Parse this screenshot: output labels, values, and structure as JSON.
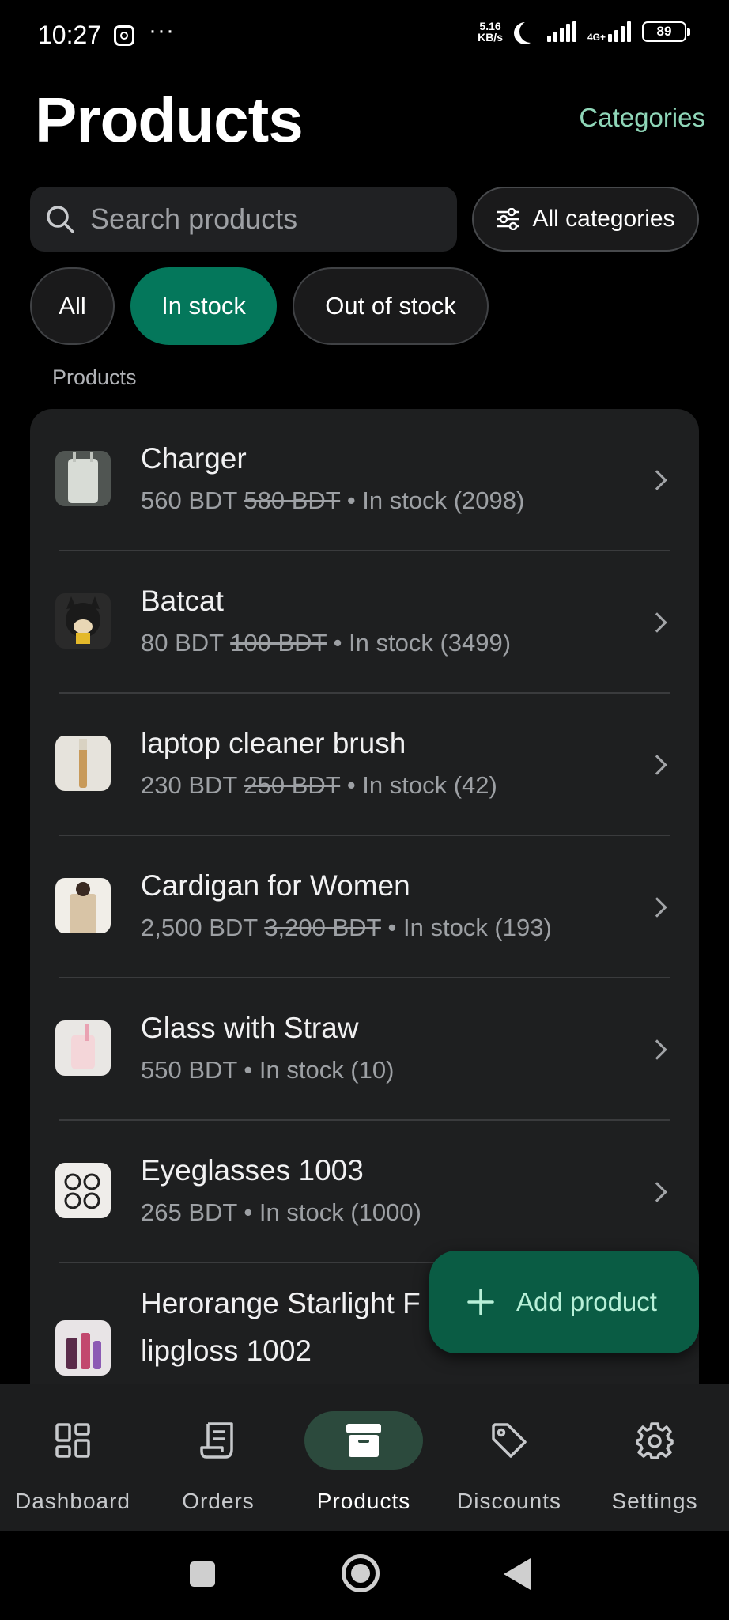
{
  "status_bar": {
    "time": "10:27",
    "more": "···",
    "net_speed_value": "5.16",
    "net_speed_unit": "KB/s",
    "network": "4G+",
    "battery": "89"
  },
  "header": {
    "title": "Products",
    "categories_link": "Categories"
  },
  "search": {
    "placeholder": "Search products",
    "value": ""
  },
  "filter": {
    "all_categories_label": "All categories"
  },
  "chips": {
    "all": "All",
    "in_stock": "In stock",
    "out_of_stock": "Out of stock",
    "selected": "In stock"
  },
  "section_label": "Products",
  "products": [
    {
      "name": "Charger",
      "price": "560 BDT",
      "old_price": "580 BDT",
      "stock": "• In stock (2098)",
      "thumb": "charger"
    },
    {
      "name": "Batcat",
      "price": "80 BDT",
      "old_price": "100 BDT",
      "stock": "• In stock (3499)",
      "thumb": "batcat"
    },
    {
      "name": "laptop cleaner brush",
      "price": "230 BDT",
      "old_price": "250 BDT",
      "stock": "• In stock (42)",
      "thumb": "brush"
    },
    {
      "name": "Cardigan for Women",
      "price": "2,500 BDT",
      "old_price": "3,200 BDT",
      "stock": "• In stock (193)",
      "thumb": "cardigan"
    },
    {
      "name": "Glass with Straw",
      "price": "550 BDT",
      "old_price": "",
      "stock": "• In stock (10)",
      "thumb": "glass"
    },
    {
      "name": "Eyeglasses 1003",
      "price": "265 BDT",
      "old_price": "",
      "stock": "• In stock (1000)",
      "thumb": "eyeglasses"
    },
    {
      "name_line1": "Herorange Starlight F",
      "name_line2": "lipgloss 1002",
      "thumb": "lipgloss"
    }
  ],
  "fab": {
    "label": "Add product",
    "icon": "plus-icon"
  },
  "bottom_nav": {
    "dashboard": "Dashboard",
    "orders": "Orders",
    "products": "Products",
    "discounts": "Discounts",
    "settings": "Settings",
    "active": "Products"
  },
  "colors": {
    "accent": "#04775b",
    "fab_bg": "#0a5c44",
    "link": "#8fd6b8",
    "background": "#000000",
    "card": "#1e1f20"
  }
}
